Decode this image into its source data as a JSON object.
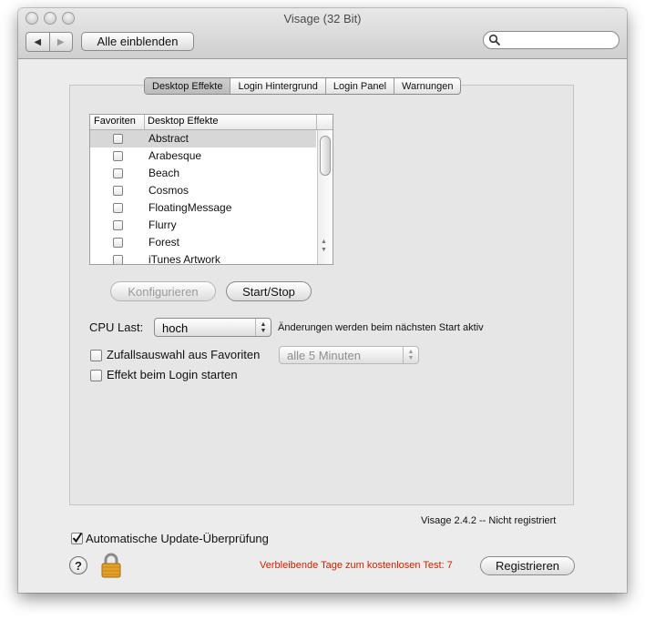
{
  "window": {
    "title": "Visage (32 Bit)"
  },
  "toolbar": {
    "back_glyph": "◀",
    "forward_glyph": "▶",
    "show_all_label": "Alle einblenden",
    "search_placeholder": "",
    "search_value": ""
  },
  "tabs": [
    {
      "label": "Desktop Effekte",
      "selected": true
    },
    {
      "label": "Login Hintergrund",
      "selected": false
    },
    {
      "label": "Login Panel",
      "selected": false
    },
    {
      "label": "Warnungen",
      "selected": false
    }
  ],
  "table": {
    "columns": [
      "Favoriten",
      "Desktop Effekte"
    ],
    "rows": [
      {
        "name": "Abstract",
        "favorite": false,
        "selected": true
      },
      {
        "name": "Arabesque",
        "favorite": false,
        "selected": false
      },
      {
        "name": "Beach",
        "favorite": false,
        "selected": false
      },
      {
        "name": "Cosmos",
        "favorite": false,
        "selected": false
      },
      {
        "name": "FloatingMessage",
        "favorite": false,
        "selected": false
      },
      {
        "name": "Flurry",
        "favorite": false,
        "selected": false
      },
      {
        "name": "Forest",
        "favorite": false,
        "selected": false
      },
      {
        "name": "iTunes Artwork",
        "favorite": false,
        "selected": false
      }
    ]
  },
  "actions": {
    "configure_label": "Konfigurieren",
    "startstop_label": "Start/Stop"
  },
  "cpu": {
    "label": "CPU Last:",
    "value": "hoch",
    "note": "Änderungen werden beim nächsten Start aktiv"
  },
  "random": {
    "label": "Zufallsauswahl aus Favoriten",
    "checked": false,
    "interval_value": "alle 5 Minuten"
  },
  "login_effect": {
    "label": "Effekt beim Login starten",
    "checked": false
  },
  "version": "Visage 2.4.2 -- Nicht registriert",
  "auto_update": {
    "label": "Automatische Update-Überprüfung",
    "checked": true
  },
  "help_glyph": "?",
  "trial": {
    "text": "Verbleibende Tage zum kostenlosen Test: 7",
    "color": "#cc2200"
  },
  "register_label": "Registrieren",
  "icons": {
    "lock": "lock-icon",
    "search": "search-icon",
    "help": "help-icon"
  }
}
